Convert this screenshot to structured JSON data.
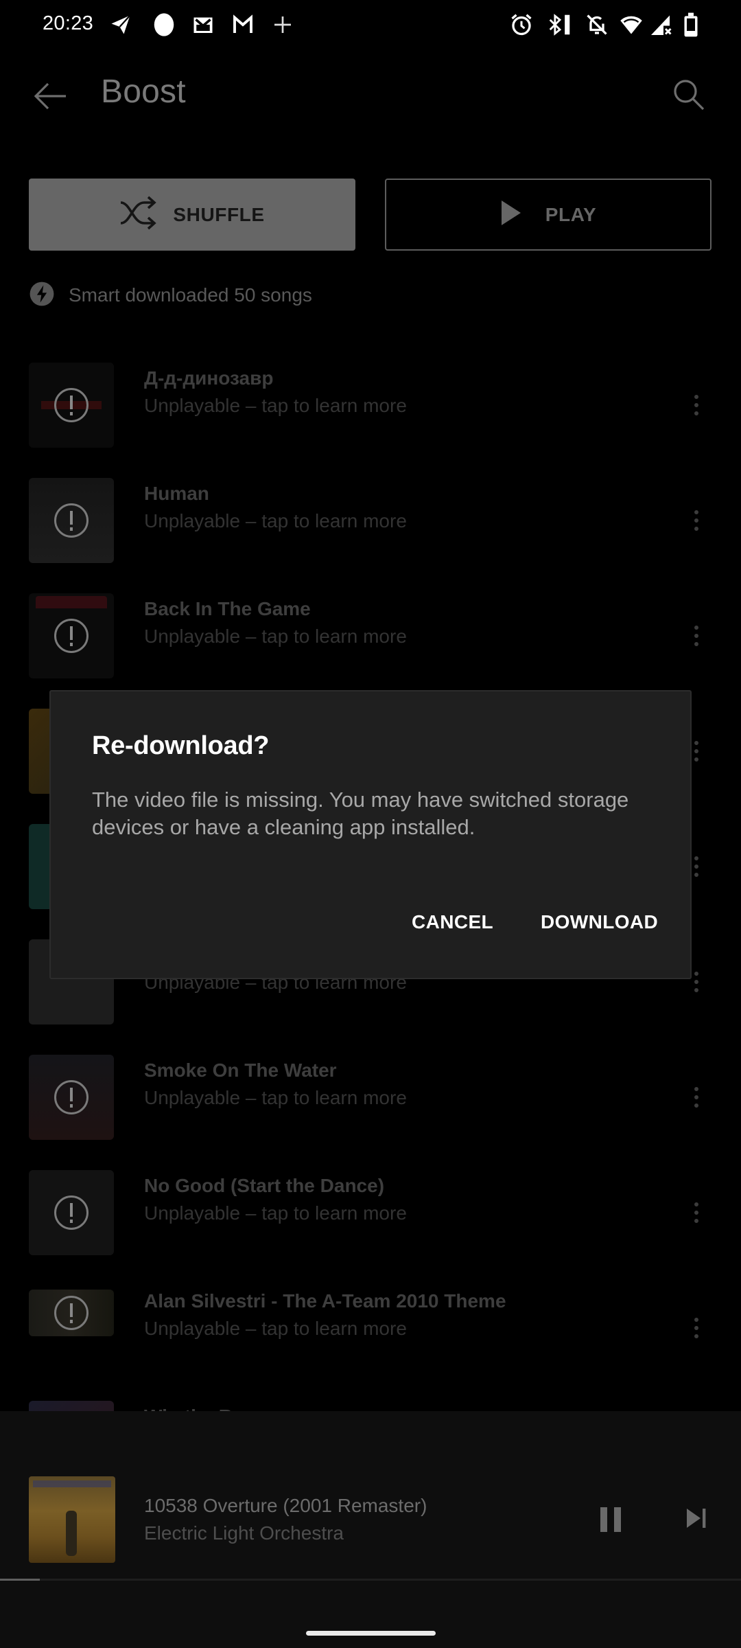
{
  "status_bar": {
    "time": "20:23",
    "left_icons": [
      "telegram-icon",
      "circle-notification-icon",
      "mail-icon",
      "gmail-icon",
      "plus-icon"
    ],
    "right_icons": [
      "alarm-icon",
      "bluetooth-vibrate-icon",
      "notifications-off-icon",
      "wifi-icon",
      "cell-signal-no-service-icon",
      "battery-icon"
    ]
  },
  "header": {
    "title": "Boost",
    "back_icon": "arrow-left-icon",
    "search_icon": "search-icon"
  },
  "actions": {
    "shuffle_label": "SHUFFLE",
    "play_label": "PLAY"
  },
  "smart_download": {
    "text": "Smart downloaded 50 songs",
    "icon": "lightning-bolt-icon"
  },
  "songs": [
    {
      "title": "Д-д-динозавр",
      "subtitle": "Unplayable – tap to learn more",
      "art_color": "#0a0a0a"
    },
    {
      "title": "Human",
      "subtitle": "Unplayable – tap to learn more",
      "art_color": "#161616"
    },
    {
      "title": "Back In The Game",
      "subtitle": "Unplayable – tap to learn more",
      "art_color": "#0b0b0b"
    },
    {
      "title": "",
      "subtitle": "",
      "art_color": "#3a2a0c"
    },
    {
      "title": "",
      "subtitle": "",
      "art_color": "#0f2a26"
    },
    {
      "title": "",
      "subtitle": "Unplayable – tap to learn more",
      "art_color": "#1c1c1c"
    },
    {
      "title": "Smoke On The Water",
      "subtitle": "Unplayable – tap to learn more",
      "art_color": "#1a1212"
    },
    {
      "title": "No Good (Start the Dance)",
      "subtitle": "Unplayable – tap to learn more",
      "art_color": "#121212"
    },
    {
      "title": "Alan Silvestri - The A-Team 2010 Theme",
      "subtitle": "Unplayable – tap to learn more",
      "art_color": "#1a1a16"
    },
    {
      "title": "Win the Race",
      "subtitle": "",
      "art_color": "#2a1418"
    }
  ],
  "now_playing": {
    "title": "10538 Overture (2001 Remaster)",
    "artist": "Electric Light Orchestra",
    "progress_percent": 5.4,
    "pause_icon": "pause-icon",
    "next_icon": "skip-next-icon"
  },
  "dialog": {
    "title": "Re-download?",
    "message": "The video file is missing. You may have switched storage devices or have a cleaning app installed.",
    "cancel_label": "CANCEL",
    "confirm_label": "DOWNLOAD"
  }
}
